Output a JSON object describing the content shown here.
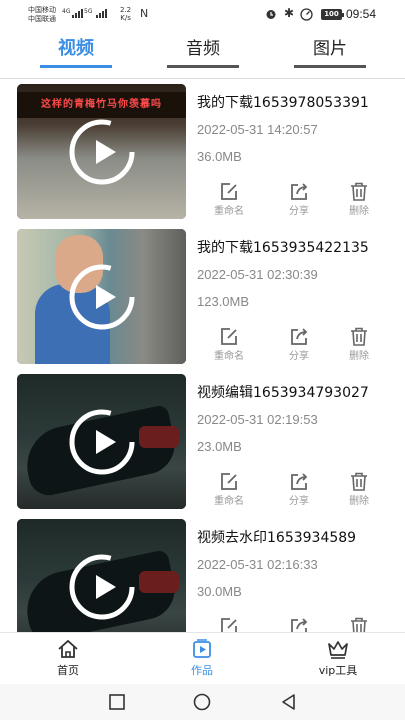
{
  "status_bar": {
    "carrier_1": "中国移动",
    "carrier_2": "中国联通",
    "net_1": "4G",
    "net_2": "5G",
    "speed_value": "2.2",
    "speed_unit": "K/s",
    "nfc": "N",
    "battery": "100",
    "time": "09:54"
  },
  "tabs": [
    {
      "label": "视频",
      "active": true
    },
    {
      "label": "音频",
      "active": false
    },
    {
      "label": "图片",
      "active": false
    }
  ],
  "thumb_caption": "这样的青梅竹马你羡慕吗",
  "items": [
    {
      "title": "我的下载1653978053391",
      "date": "2022-05-31 14:20:57",
      "size": "36.0MB"
    },
    {
      "title": "我的下载1653935422135",
      "date": "2022-05-31 02:30:39",
      "size": "123.0MB"
    },
    {
      "title": "视频编辑1653934793027",
      "date": "2022-05-31 02:19:53",
      "size": "23.0MB"
    },
    {
      "title": "视频去水印1653934589",
      "date": "2022-05-31 02:16:33",
      "size": "30.0MB"
    }
  ],
  "actions": {
    "rename": "重命名",
    "share": "分享",
    "delete": "删除"
  },
  "bottom_nav": [
    {
      "label": "首页",
      "icon": "home-icon",
      "active": false
    },
    {
      "label": "作品",
      "icon": "works-icon",
      "active": true
    },
    {
      "label": "vip工具",
      "icon": "crown-icon",
      "active": false
    }
  ],
  "colors": {
    "accent": "#3a8ee6",
    "muted": "#999999"
  }
}
